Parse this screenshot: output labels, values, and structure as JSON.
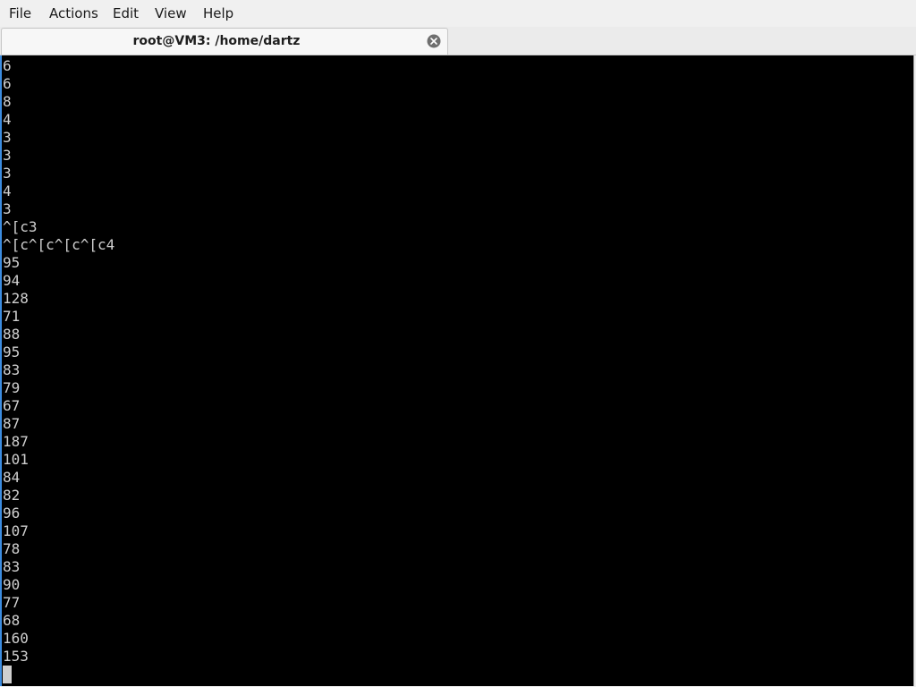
{
  "menubar": {
    "items": [
      "File",
      "Actions",
      "Edit",
      "View",
      "Help"
    ]
  },
  "tab": {
    "title": "root@VM3: /home/dartz"
  },
  "terminal": {
    "lines": [
      "6",
      "6",
      "8",
      "4",
      "3",
      "3",
      "3",
      "4",
      "3",
      "^[c3",
      "^[c^[c^[c^[c4",
      "95",
      "94",
      "128",
      "71",
      "88",
      "95",
      "83",
      "79",
      "67",
      "87",
      "187",
      "101",
      "84",
      "82",
      "96",
      "107",
      "78",
      "83",
      "90",
      "77",
      "68",
      "160",
      "153"
    ]
  },
  "icons": {
    "tab_close": "close-icon"
  },
  "colors": {
    "terminal_bg": "#000000",
    "terminal_fg": "#cfcfcf",
    "focus_border": "#3c8ce0"
  }
}
